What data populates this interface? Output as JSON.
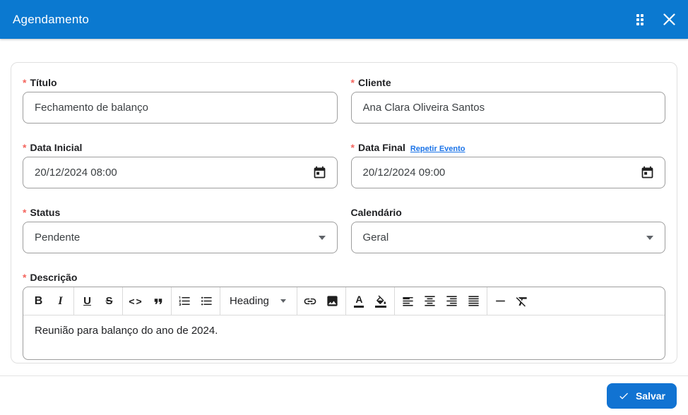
{
  "ui": {
    "required_marker": "*"
  },
  "header": {
    "title": "Agendamento"
  },
  "fields": {
    "titulo": {
      "label": "Título",
      "value": "Fechamento de balanço"
    },
    "cliente": {
      "label": "Cliente",
      "value": "Ana Clara Oliveira Santos"
    },
    "data_inicial": {
      "label": "Data Inicial",
      "value": "20/12/2024 08:00"
    },
    "data_final": {
      "label": "Data Final",
      "repeat_link": "Repetir Evento",
      "value": "20/12/2024 09:00"
    },
    "status": {
      "label": "Status",
      "value": "Pendente"
    },
    "calendario": {
      "label": "Calendário",
      "value": "Geral"
    },
    "descricao": {
      "label": "Descrição",
      "value": "Reunião para balanço do ano de 2024."
    }
  },
  "editor_toolbar": {
    "bold": "B",
    "italic": "I",
    "underline": "U",
    "strikethrough": "S",
    "code": "<>",
    "heading": "Heading",
    "text_color": "A"
  },
  "footer": {
    "save": "Salvar"
  },
  "colors": {
    "header_bg": "#0b79d0",
    "accent": "#1173d2",
    "link": "#1a73e8",
    "required": "#f4665f"
  }
}
